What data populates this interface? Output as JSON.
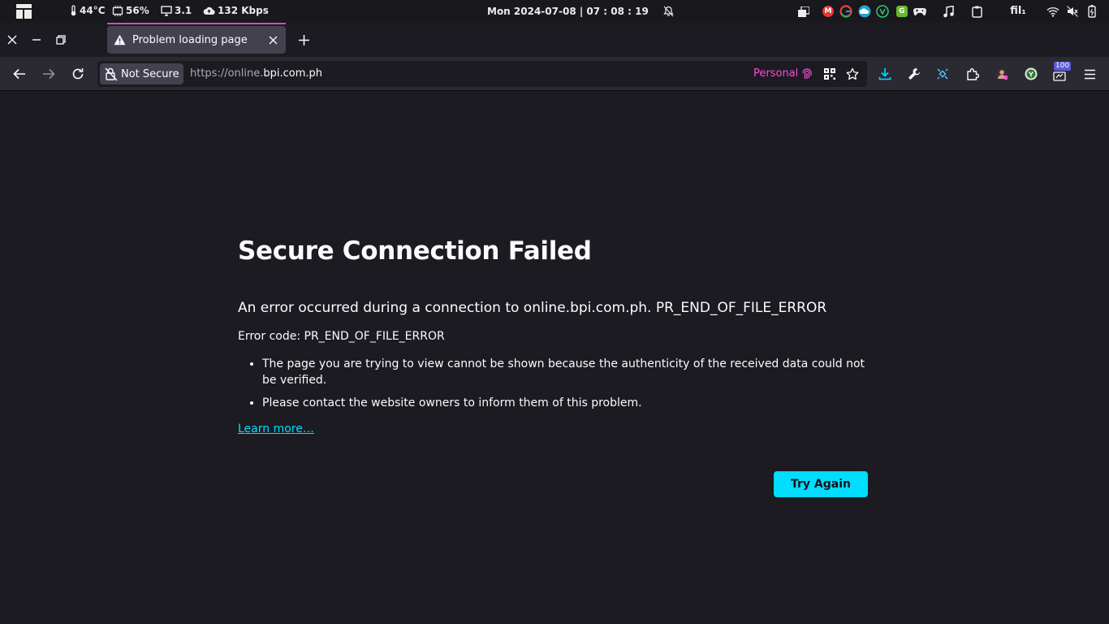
{
  "system_bar": {
    "temperature": "44°C",
    "battery": "56%",
    "display": "3.1",
    "network_speed": "132 Kbps",
    "clock": "Mon 2024-07-08 | 07 : 08 : 19",
    "keyboard_layout": "fil₁",
    "tray_icons": [
      "window-switch-icon",
      "gmail-icon",
      "google-icon",
      "cloud-icon",
      "vpn-icon",
      "app-g-icon",
      "gamepad-icon",
      "music-icon",
      "clipboard-icon",
      "wifi-icon",
      "volume-muted-icon",
      "battery-icon"
    ]
  },
  "browser": {
    "tab": {
      "title": "Problem loading page",
      "icon": "warning-icon"
    },
    "security_label": "Not Secure",
    "url": {
      "prefix": "https://online.",
      "host": "bpi.com.ph"
    },
    "container_label": "Personal",
    "toolbar_icons": [
      "download-icon",
      "wrench-icon",
      "satellite-icon",
      "extensions-icon",
      "avatar-extension-icon",
      "shield-extension-icon",
      "counter-extension-icon",
      "menu-icon"
    ],
    "badge_count": "100",
    "accent": "#00ddff",
    "container_color": "#ff4bda",
    "tab_indicator_color": "#c850c0"
  },
  "error_page": {
    "title": "Secure Connection Failed",
    "short_desc": "An error occurred during a connection to online.bpi.com.ph. PR_END_OF_FILE_ERROR",
    "error_code": "Error code: PR_END_OF_FILE_ERROR",
    "bullets": [
      "The page you are trying to view cannot be shown because the authenticity of the received data could not be verified.",
      "Please contact the website owners to inform them of this problem."
    ],
    "learn_more": "Learn more…",
    "try_again": "Try Again"
  }
}
